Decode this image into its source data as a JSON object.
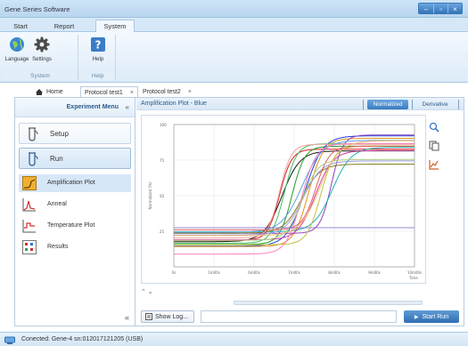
{
  "window": {
    "title": "Gene Series Software"
  },
  "ribbon": {
    "tabs": [
      {
        "label": "Start"
      },
      {
        "label": "Report"
      },
      {
        "label": "System"
      }
    ],
    "groups": [
      {
        "label": "System",
        "buttons": [
          {
            "label": "Language",
            "icon": "globe-icon"
          },
          {
            "label": "Settings",
            "icon": "gear-icon"
          }
        ]
      },
      {
        "label": "Help",
        "buttons": [
          {
            "label": "Help",
            "icon": "help-icon"
          }
        ]
      }
    ]
  },
  "doc_tabs": [
    {
      "label": "Home"
    },
    {
      "label": "Protocol test1",
      "close": "×"
    },
    {
      "label": "Protocol test2",
      "close": "×"
    }
  ],
  "sidebar": {
    "title": "Experiment Menu",
    "collapse_glyph": "«",
    "sections": [
      {
        "label": "Setup"
      },
      {
        "label": "Run"
      }
    ],
    "items": [
      {
        "label": "Amplification Plot"
      },
      {
        "label": "Anneal"
      },
      {
        "label": "Temperature Plot"
      },
      {
        "label": "Results"
      }
    ],
    "footer_glyph": "«"
  },
  "plot": {
    "title": "Amplification Plot - Blue",
    "modes": [
      {
        "label": "Normalized"
      },
      {
        "label": "Derivative"
      }
    ]
  },
  "chart_data": {
    "type": "line",
    "ylabel": "Normalized (%)",
    "xlabel": "Time",
    "yticks": [
      "100",
      "75",
      "50",
      "25"
    ],
    "xticks": [
      "0s",
      "1m00s",
      "6m00s",
      "7m00s",
      "8m00s",
      "9m00s",
      "10m00s"
    ],
    "series_colors": [
      "#1a1a1a",
      "#e02020",
      "#20a020",
      "#2040d0",
      "#e09020",
      "#9040c0",
      "#20b0b0",
      "#d040a0",
      "#808020",
      "#40c060",
      "#f0a0a0",
      "#a0a0e0",
      "#c0c040",
      "#60a0e0",
      "#e06060",
      "#ff80c0",
      "#b0d080",
      "#f0c070"
    ]
  },
  "plot_nav": {
    "glyphs": "⌃ ⌄"
  },
  "bottom": {
    "show_log_label": "Show Log...",
    "start_run_label": "Start Run"
  },
  "status": {
    "text": "Conected: Gene-4 sn:012017121205 (USB)"
  }
}
